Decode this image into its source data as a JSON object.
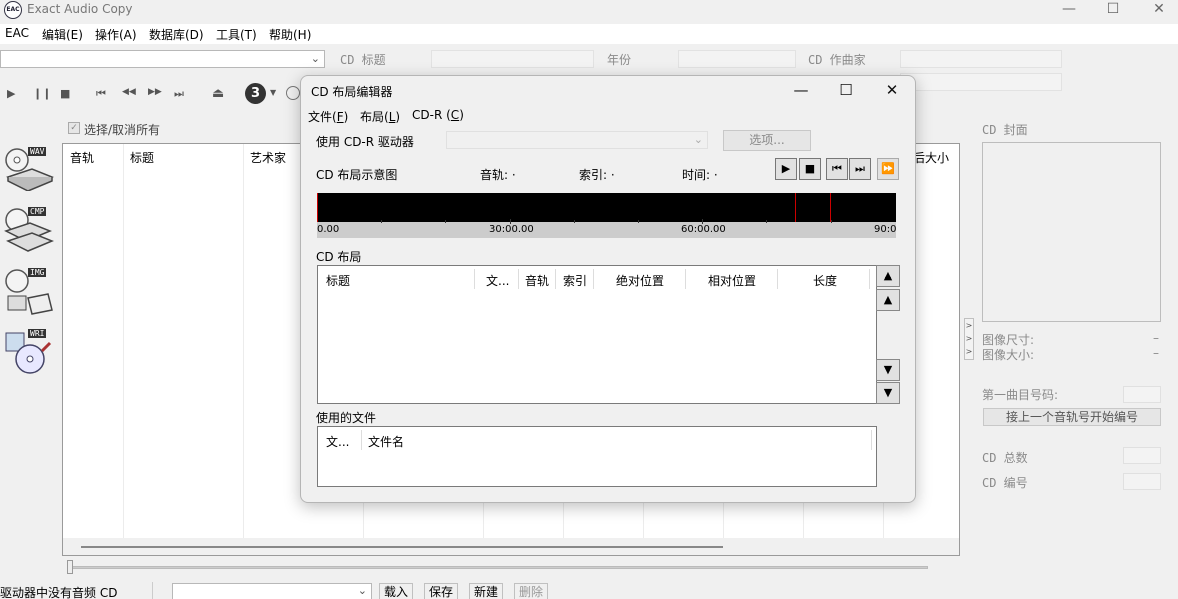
{
  "window": {
    "title": "Exact Audio Copy",
    "icon_name": "eac-app-icon",
    "minimize": "—",
    "maximize": "☐",
    "close": "✕"
  },
  "menubar": [
    {
      "label": "EAC"
    },
    {
      "label": "编辑(E)"
    },
    {
      "label": "操作(A)"
    },
    {
      "label": "数据库(D)"
    },
    {
      "label": "工具(T)"
    },
    {
      "label": "帮助(H)"
    }
  ],
  "fields": {
    "cd_title_label": "CD 标题",
    "year_label": "年份",
    "composer_label": "CD 作曲家"
  },
  "toolbar": {
    "play": "▶",
    "pause": "❙❙",
    "stop": "■",
    "first": "⏮",
    "prev": "◀◀",
    "next": "▶▶",
    "last": "⏭",
    "eject": "⏏",
    "speed_badge": "3"
  },
  "left_actions": [
    {
      "tag": "WAV"
    },
    {
      "tag": "CMP"
    },
    {
      "tag": "IMG"
    },
    {
      "tag": "WRI"
    }
  ],
  "select_all": {
    "label": "选择/取消所有",
    "checked": true
  },
  "main_list": {
    "columns": [
      "音轨",
      "标题",
      "艺术家"
    ],
    "right_column_partial": "后大小"
  },
  "right_panel": {
    "cover_label": "CD 封面",
    "image_size_label": "图像尺寸:",
    "image_size_value": "–",
    "image_filesize_label": "图像大小:",
    "image_filesize_value": "–",
    "first_track_label": "第一曲目号码:",
    "continue_button": "接上一个音轨号开始编号",
    "cd_total_label": "CD 总数",
    "cd_number_label": "CD 编号"
  },
  "dialog": {
    "title": "CD 布局编辑器",
    "menu": [
      {
        "label": "文件(",
        "key": "F",
        "suffix": ")"
      },
      {
        "label": "布局(",
        "key": "L",
        "suffix": ")"
      },
      {
        "label": "CD-R (",
        "key": "C",
        "suffix": ")"
      }
    ],
    "drive_label": "使用 CD-R 驱动器",
    "options_button": "选项...",
    "layout_view_label": "CD 布局示意图",
    "track_label": "音轨: ·",
    "index_label": "索引: ·",
    "time_label": "时间: ·",
    "ruler_ticks": [
      "0.00",
      "30:00.00",
      "60:00.00",
      "90:0"
    ],
    "layout_label": "CD 布局",
    "layout_columns": [
      "标题",
      "文...",
      "音轨",
      "索引",
      "绝对位置",
      "相对位置",
      "长度"
    ],
    "files_label": "使用的文件",
    "file_columns": [
      "文...",
      "文件名"
    ]
  },
  "statusbar": {
    "message": "驱动器中没有音频 CD",
    "load_button": "载入",
    "save_button": "保存",
    "new_button": "新建",
    "delete_button": "删除"
  }
}
